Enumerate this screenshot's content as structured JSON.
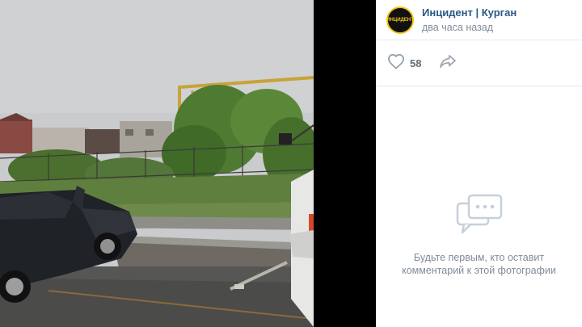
{
  "post": {
    "group_name": "Инцидент | Курган",
    "time": "два часа назад",
    "avatar_logo": "ИНЦИДЕНТ"
  },
  "actions": {
    "like_count": "58",
    "like_icon": "heart-icon",
    "share_icon": "share-arrow-icon"
  },
  "comments": {
    "icon": "chat-bubbles-icon",
    "empty_line1": "Будьте первым, кто оставит",
    "empty_line2": "комментарий к этой фотографии"
  },
  "colors": {
    "link": "#2a5885",
    "secondary_text": "#818c99",
    "logo_accent": "#f0c419"
  }
}
